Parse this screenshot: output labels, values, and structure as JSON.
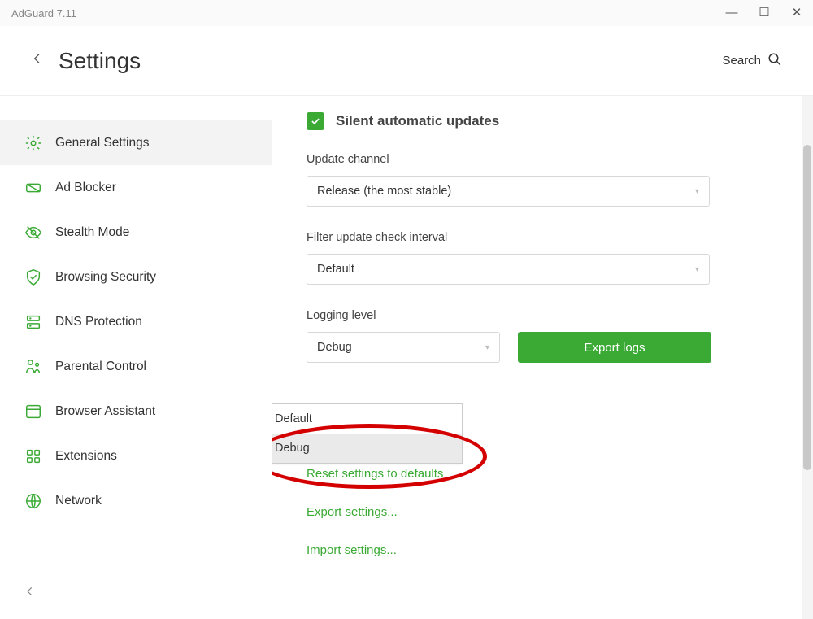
{
  "window": {
    "title": "AdGuard 7.11"
  },
  "header": {
    "title": "Settings",
    "search": "Search"
  },
  "sidebar": {
    "items": [
      {
        "label": "General Settings"
      },
      {
        "label": "Ad Blocker"
      },
      {
        "label": "Stealth Mode"
      },
      {
        "label": "Browsing Security"
      },
      {
        "label": "DNS Protection"
      },
      {
        "label": "Parental Control"
      },
      {
        "label": "Browser Assistant"
      },
      {
        "label": "Extensions"
      },
      {
        "label": "Network"
      }
    ]
  },
  "content": {
    "silent_updates_label": "Silent automatic updates",
    "silent_updates_checked": true,
    "update_channel": {
      "label": "Update channel",
      "value": "Release (the most stable)"
    },
    "filter_interval": {
      "label": "Filter update check interval",
      "value": "Default"
    },
    "logging": {
      "label": "Logging level",
      "value": "Debug",
      "options": [
        "Default",
        "Debug"
      ]
    },
    "export_logs_btn": "Export logs",
    "links": {
      "reset": "Reset settings to defaults",
      "export": "Export settings...",
      "import": "Import settings..."
    }
  }
}
